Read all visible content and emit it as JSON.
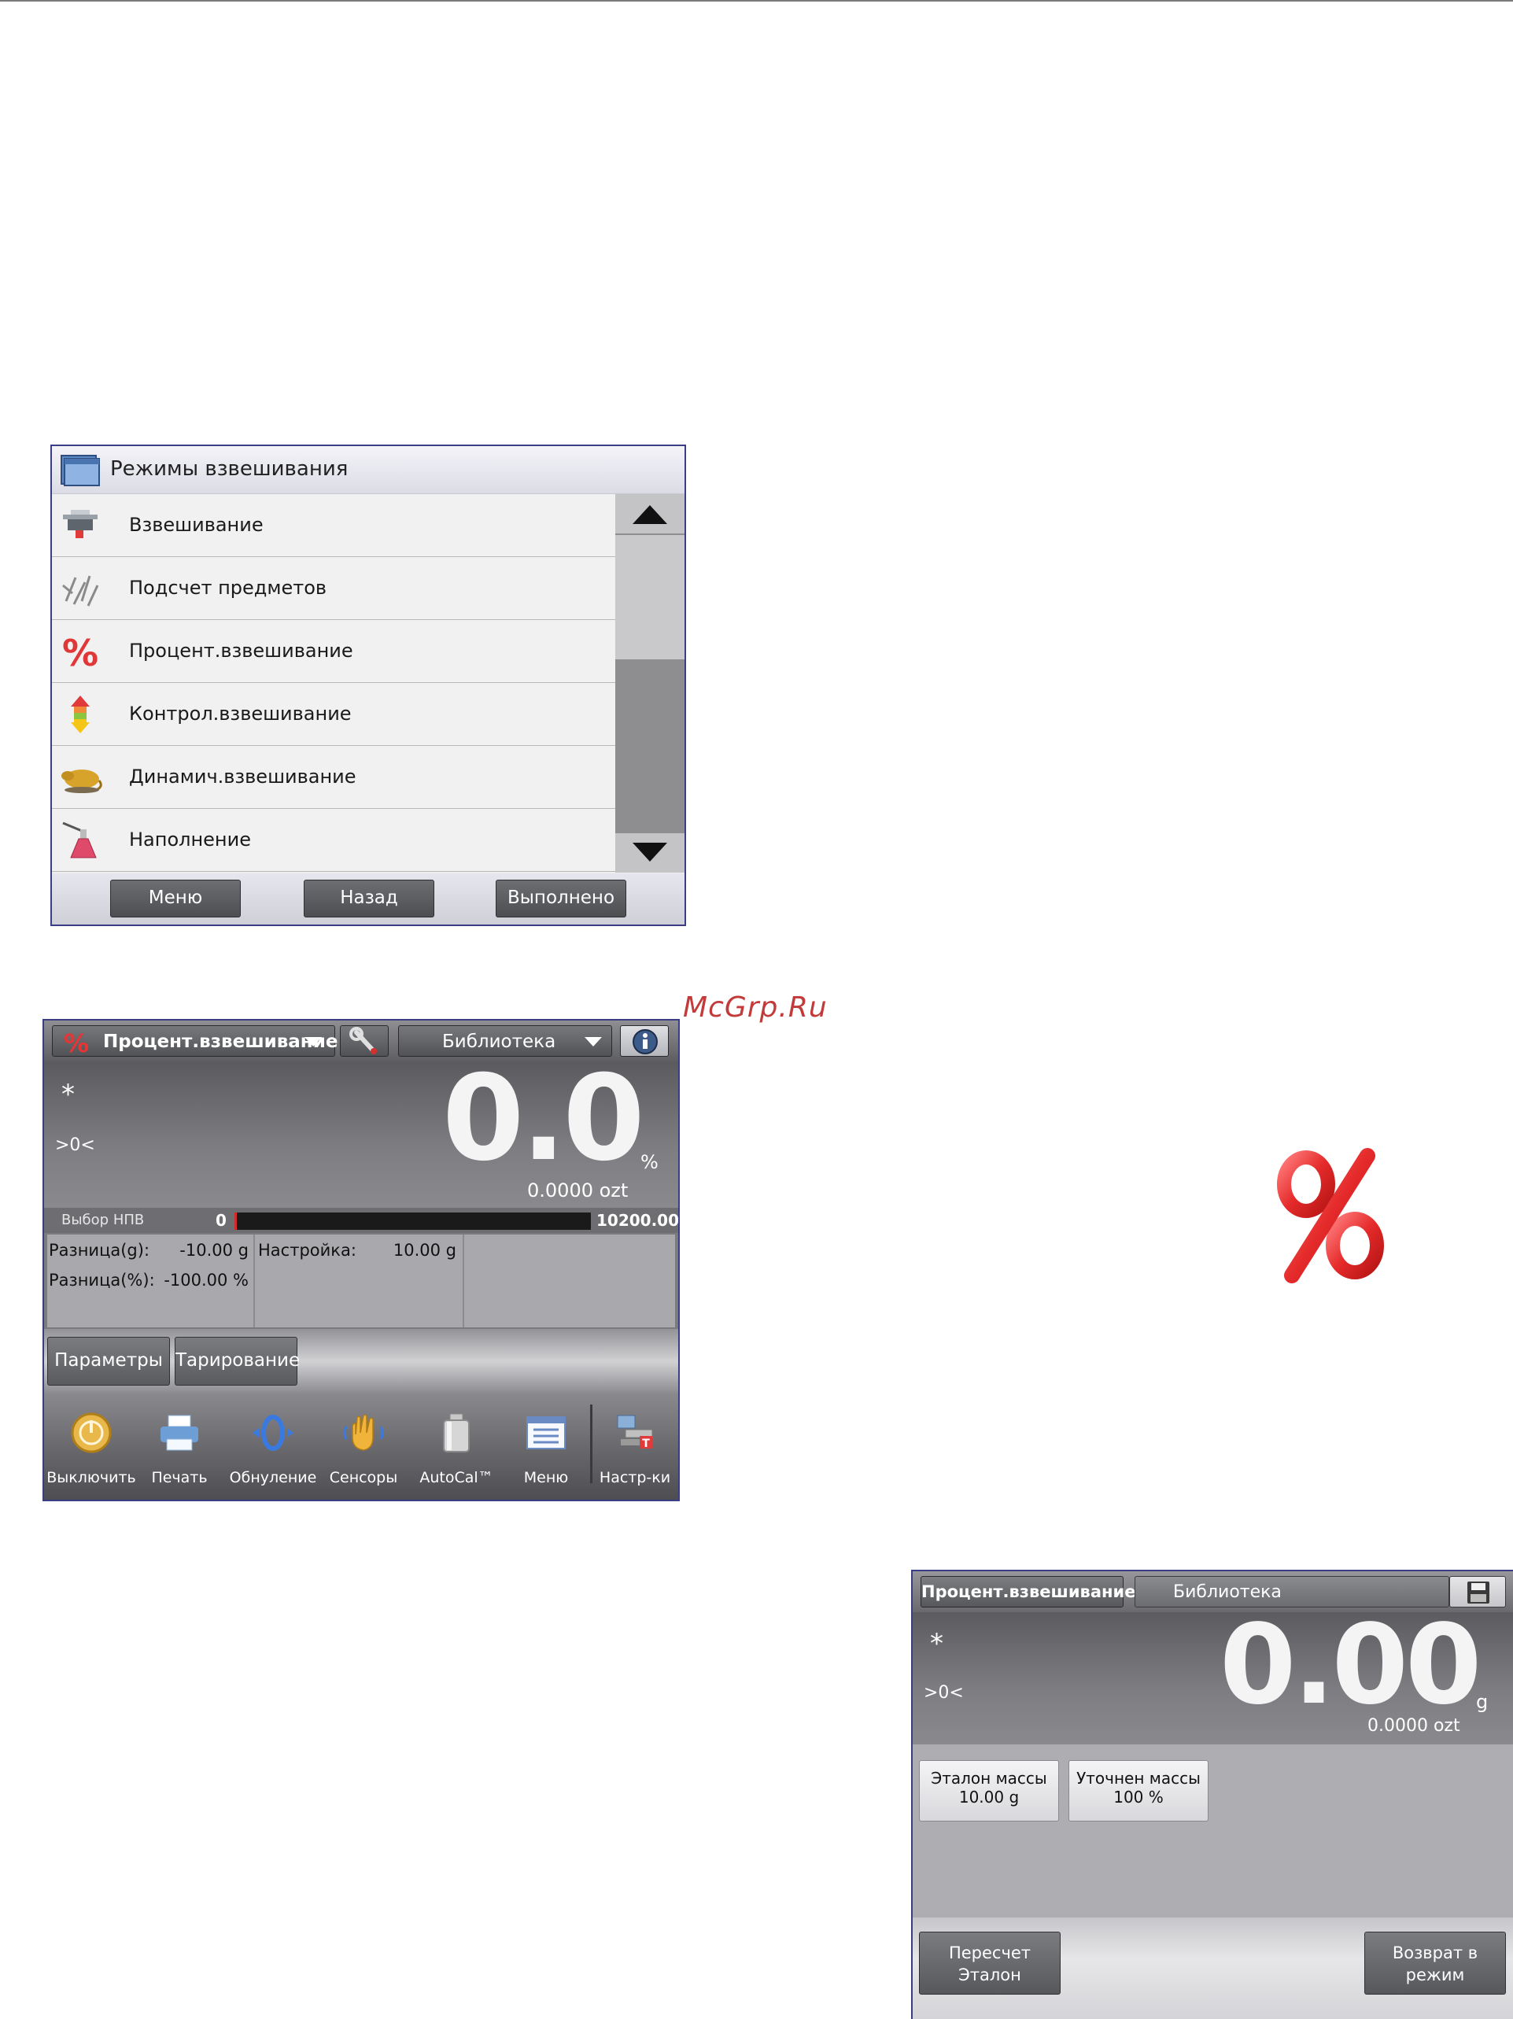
{
  "watermark": "McGrp.Ru",
  "modes_screen": {
    "title": "Режимы взвешивания",
    "items": [
      {
        "label": "Взвешивание",
        "icon": "scale-icon"
      },
      {
        "label": "Подсчет предметов",
        "icon": "parts-counting-icon"
      },
      {
        "label": "Процент.взвешивание",
        "icon": "percent-icon"
      },
      {
        "label": "Контрол.взвешивание",
        "icon": "check-weighing-icon"
      },
      {
        "label": "Динамич.взвешивание",
        "icon": "animal-weighing-icon"
      },
      {
        "label": "Наполнение",
        "icon": "filling-icon"
      }
    ],
    "buttons": {
      "menu": "Меню",
      "back": "Назад",
      "done": "Выполнено"
    }
  },
  "percent_screen": {
    "mode_label": "Процент.взвешивание",
    "library_label": "Библиотека",
    "stable_mark": "*",
    "zero_mark": ">0<",
    "reading": "0.0",
    "unit": "%",
    "secondary_reading": "0.0000 ozt",
    "npv": {
      "label": "Выбор НПВ",
      "min": "0",
      "max": "10200.00"
    },
    "info": {
      "diff_g_label": "Разница(g):",
      "diff_g_value": "-10.00 g",
      "diff_pct_label": "Разница(%):",
      "diff_pct_value": "-100.00 %",
      "setting_label": "Настройка:",
      "setting_value": "10.00 g"
    },
    "buttons": {
      "params": "Параметры",
      "tare": "Тарирование"
    },
    "nav": [
      {
        "label": "Выключить",
        "icon": "power-icon"
      },
      {
        "label": "Печать",
        "icon": "printer-icon"
      },
      {
        "label": "Обнуление",
        "icon": "zero-icon"
      },
      {
        "label": "Сенсоры",
        "icon": "sensor-hand-icon"
      },
      {
        "label": "AutoCal™",
        "icon": "calibration-weight-icon"
      },
      {
        "label": "Меню",
        "icon": "menu-list-icon"
      },
      {
        "label": "Настр-ки",
        "icon": "setup-icon"
      }
    ]
  },
  "reference_screen": {
    "mode_label": "Процент.взвешивание",
    "library_label": "Библиотека",
    "stable_mark": "*",
    "zero_mark": ">0<",
    "reading": "0.00",
    "unit": "g",
    "secondary_reading": "0.0000 ozt",
    "ref_mass": {
      "label": "Эталон массы",
      "value": "10.00 g"
    },
    "adj_mass": {
      "label": "Уточнен массы",
      "value": "100 %"
    },
    "recalc": {
      "line1": "Пересчет",
      "line2": "Эталон"
    },
    "return": {
      "line1": "Возврат в",
      "line2": "режим"
    }
  },
  "colors": {
    "accent_red": "#d42a2a",
    "frame_blue": "#3b3d86"
  }
}
